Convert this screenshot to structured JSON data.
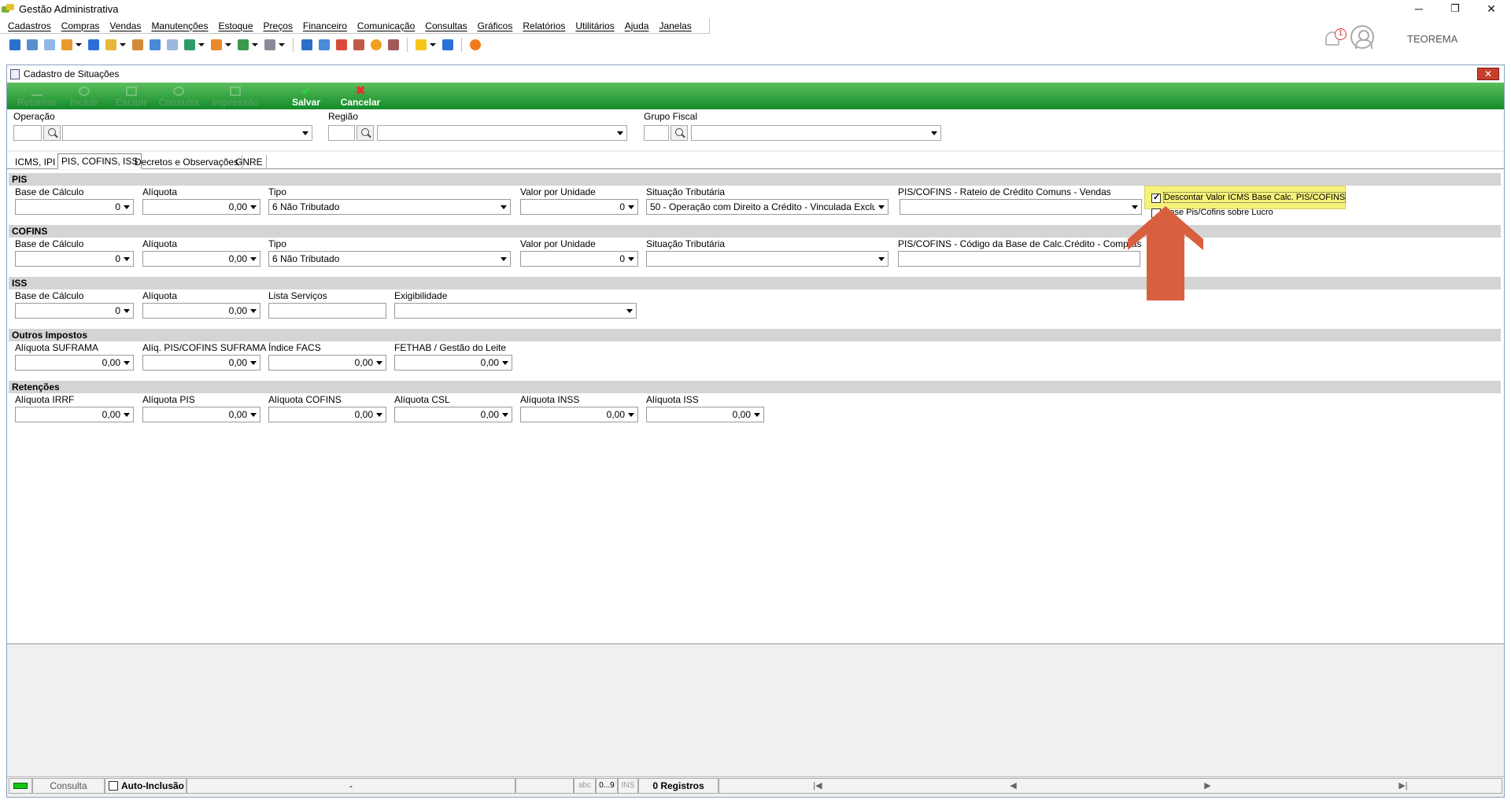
{
  "window": {
    "title": "Gestão Administrativa",
    "minimize": "─",
    "restore": "❐",
    "close": "✕"
  },
  "menu": [
    "Cadastros",
    "Compras",
    "Vendas",
    "Manutenções",
    "Estoque",
    "Preços",
    "Financeiro",
    "Comunicação",
    "Consultas",
    "Gráficos",
    "Relatórios",
    "Utilitários",
    "Ajuda",
    "Janelas"
  ],
  "notifications": {
    "count": "1"
  },
  "user": {
    "name": "TEOREMA"
  },
  "form": {
    "title": "Cadastro de Situações",
    "close": "✕",
    "actions": {
      "retornar": "Retornar",
      "incluir": "Incluir",
      "excluir": "Excluir",
      "consulta": "Consulta",
      "impressao": "Impressão",
      "salvar": "Salvar",
      "cancelar": "Cancelar"
    },
    "filters": {
      "operacao": "Operação",
      "regiao": "Região",
      "grupo_fiscal": "Grupo Fiscal"
    },
    "tabs": [
      "ICMS, IPI",
      "PIS, COFINS, ISS",
      "Decretos e Observações",
      "GNRE"
    ],
    "pis": {
      "header": "PIS",
      "base_label": "Base de Cálculo",
      "base_value": "0",
      "aliquota_label": "Alíquota",
      "aliquota_value": "0,00",
      "tipo_label": "Tipo",
      "tipo_value": "6 Não Tributado",
      "valor_unid_label": "Valor por Unidade",
      "valor_unid_value": "0",
      "situacao_label": "Situação Tributária",
      "situacao_value": "50 - Operação com Direito a Crédito - Vinculada Exclu",
      "rateio_label": "PIS/COFINS - Rateio de Crédito Comuns - Vendas",
      "rateio_value": ""
    },
    "checkboxes": {
      "descontar_icms": "Descontar Valor ICMS Base Calc. PIS/COFINS",
      "base_lucro": "Base Pis/Cofins sobre Lucro"
    },
    "cofins": {
      "header": "COFINS",
      "base_label": "Base de Cálculo",
      "base_value": "0",
      "aliquota_label": "Alíquota",
      "aliquota_value": "0,00",
      "tipo_label": "Tipo",
      "tipo_value": "6 Não Tributado",
      "valor_unid_label": "Valor por Unidade",
      "valor_unid_value": "0",
      "situacao_label": "Situação Tributária",
      "situacao_value": "",
      "codigo_base_label": "PIS/COFINS - Código da Base de Calc.Crédito - Compras",
      "codigo_base_value": ""
    },
    "iss": {
      "header": "ISS",
      "base_label": "Base de Cálculo",
      "base_value": "0",
      "aliquota_label": "Alíquota",
      "aliquota_value": "0,00",
      "lista_label": "Lista Serviços",
      "exig_label": "Exigibilidade"
    },
    "outros": {
      "header": "Outros Impostos",
      "suframa_label": "Alíquota SUFRAMA",
      "suframa_value": "0,00",
      "pis_cofins_suframa_label": "Alíq. PIS/COFINS SUFRAMA",
      "pis_cofins_suframa_value": "0,00",
      "facs_label": "Índice FACS",
      "facs_value": "0,00",
      "fethab_label": "FETHAB / Gestão do Leite",
      "fethab_value": "0,00"
    },
    "retencoes": {
      "header": "Retenções",
      "irrf_label": "Alíquota IRRF",
      "irrf_value": "0,00",
      "pis_label": "Alíquota PIS",
      "pis_value": "0,00",
      "cofins_label": "Alíquota COFINS",
      "cofins_value": "0,00",
      "csl_label": "Alíquota CSL",
      "csl_value": "0,00",
      "inss_label": "Alíquota INSS",
      "inss_value": "0,00",
      "iss_label": "Alíquota ISS",
      "iss_value": "0,00"
    }
  },
  "status": {
    "mode": "Consulta",
    "auto_inclusao": "Auto-Inclusão",
    "dash": "-",
    "abc": "abc",
    "num": "0...9",
    "ins": "INS",
    "registros": "0 Registros",
    "first": "|◀",
    "prev": "◀",
    "next": "▶",
    "last": "▶|"
  },
  "colors": {
    "green_bar": "#138b2a",
    "highlight": "#f5f27a",
    "arrow": "#d9603e"
  }
}
